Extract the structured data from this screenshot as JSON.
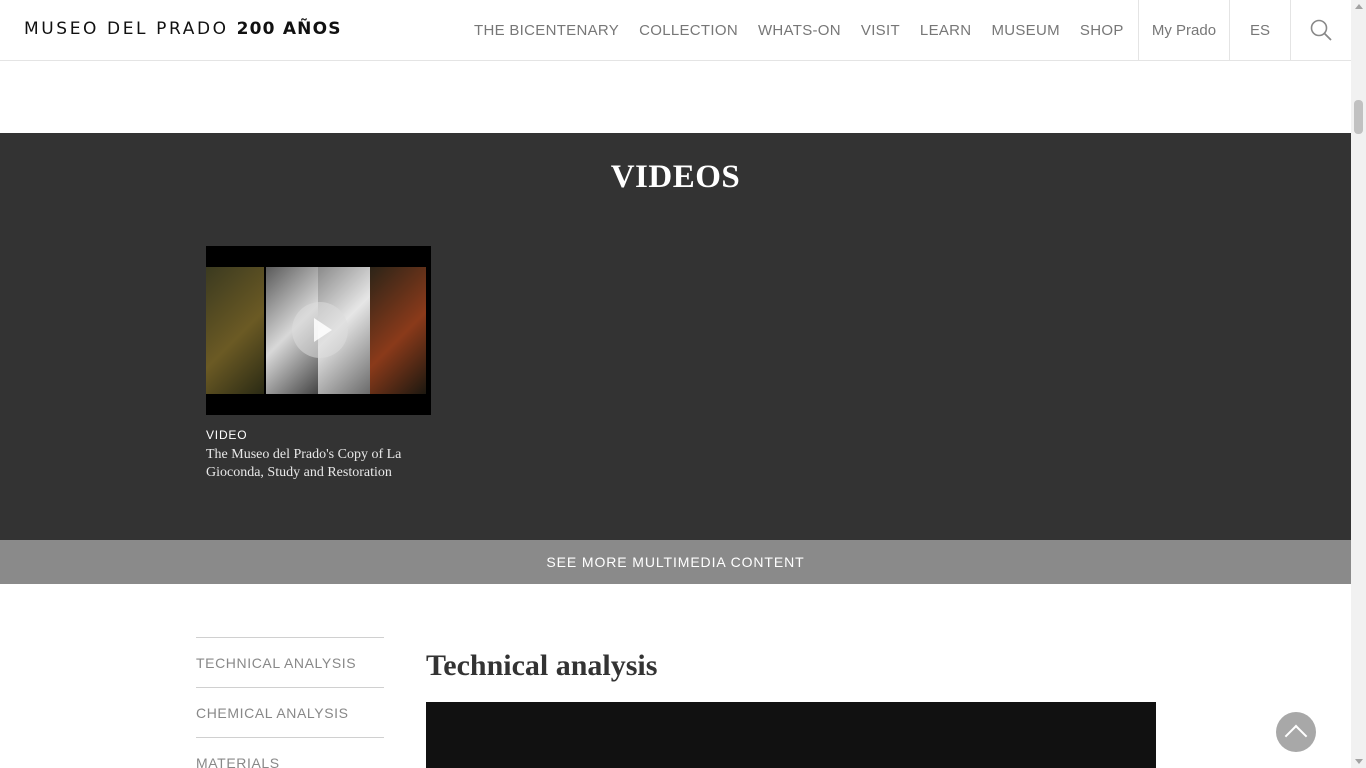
{
  "header": {
    "logo_text": "MUSEO DEL PRADO",
    "logo_bold": "200 AÑOS",
    "nav": [
      "THE BICENTENARY",
      "COLLECTION",
      "WHATS-ON",
      "VISIT",
      "LEARN",
      "MUSEUM",
      "SHOP"
    ],
    "my_prado": "My Prado",
    "language": "ES",
    "search_icon": "search-icon"
  },
  "videos": {
    "title": "VIDEOS",
    "items": [
      {
        "tag": "VIDEO",
        "title": "The Museo del Prado's Copy of La Gioconda, Study and Restoration"
      }
    ],
    "see_more": "SEE MORE MULTIMEDIA CONTENT"
  },
  "side_menu": [
    "TECHNICAL ANALYSIS",
    "CHEMICAL ANALYSIS",
    "MATERIALS"
  ],
  "main": {
    "section_title": "Technical analysis"
  },
  "colors": {
    "dark_section": "#333333",
    "see_more_bar": "#8a8a8a"
  }
}
